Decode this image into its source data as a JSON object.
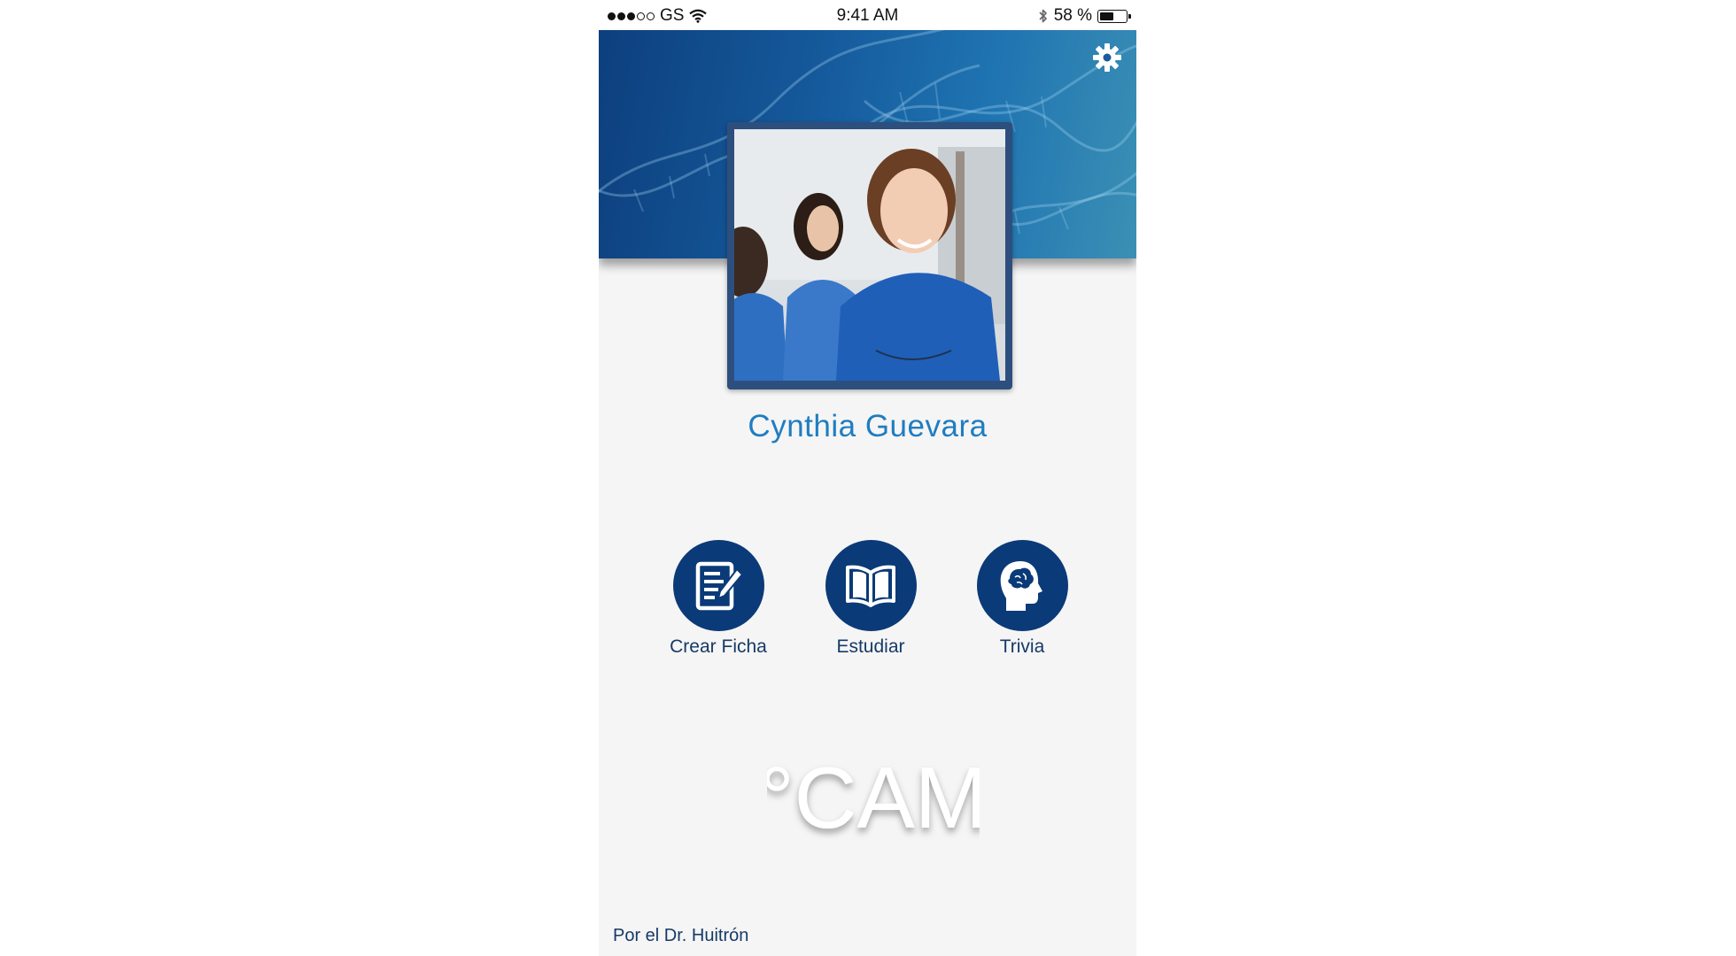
{
  "status_bar": {
    "carrier": "GS",
    "time": "9:41 AM",
    "battery_percent": "58 %",
    "battery_level": 0.58,
    "signal_bars_filled": 3,
    "signal_bars_total": 5
  },
  "header": {
    "settings_icon": "gear-icon",
    "background_color": "#155a9c"
  },
  "profile": {
    "name": "Cynthia Guevara"
  },
  "actions": [
    {
      "label": "Crear Ficha",
      "icon": "create-card-icon"
    },
    {
      "label": "Estudiar",
      "icon": "book-icon"
    },
    {
      "label": "Trivia",
      "icon": "brain-head-icon"
    }
  ],
  "logo": {
    "text": "°CAM"
  },
  "footer": {
    "credit": "Por el Dr. Huitrón"
  },
  "colors": {
    "primary": "#0b3a78",
    "name_text": "#1f7dc0",
    "label_text": "#163a66",
    "background": "#f5f5f5"
  }
}
